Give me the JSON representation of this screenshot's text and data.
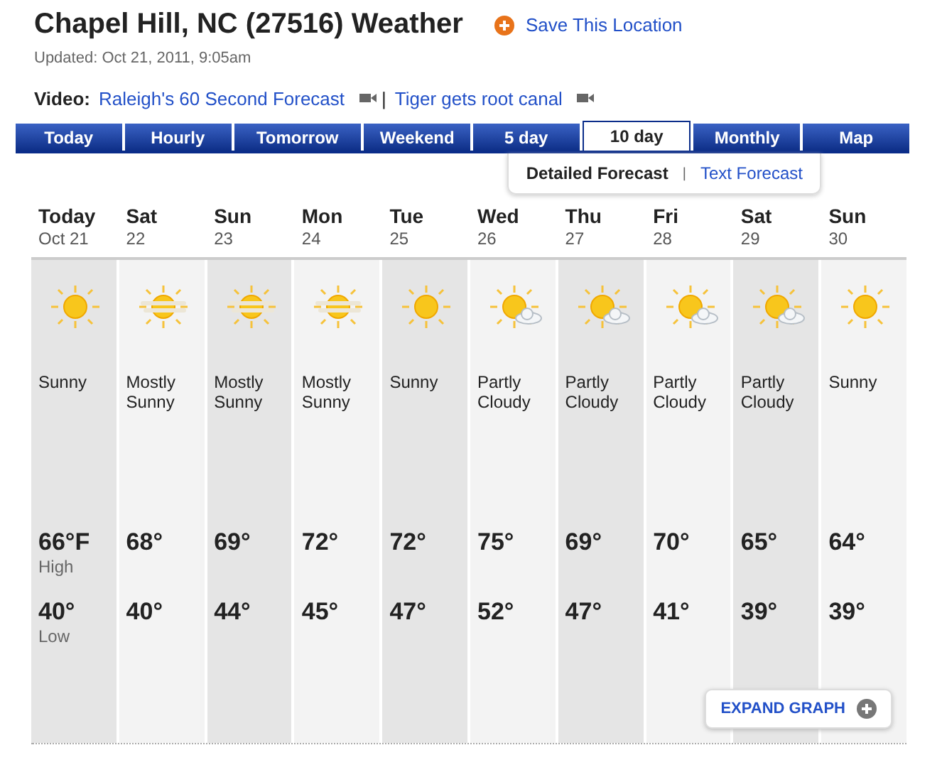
{
  "title": "Chapel Hill, NC (27516) Weather",
  "save_link": "Save This Location",
  "updated": "Updated: Oct 21, 2011, 9:05am",
  "video": {
    "label": "Video:",
    "links": [
      "Raleigh's 60 Second Forecast",
      "Tiger gets root canal"
    ],
    "separator": "|"
  },
  "tabs": [
    {
      "label": "Today",
      "selected": false
    },
    {
      "label": "Hourly",
      "selected": false
    },
    {
      "label": "Tomorrow",
      "selected": false
    },
    {
      "label": "Weekend",
      "selected": false
    },
    {
      "label": "5 day",
      "selected": false
    },
    {
      "label": "10 day",
      "selected": true
    },
    {
      "label": "Monthly",
      "selected": false
    },
    {
      "label": "Map",
      "selected": false
    }
  ],
  "subnav": {
    "items": [
      {
        "label": "Detailed Forecast",
        "selected": true
      },
      {
        "label": "Text Forecast",
        "selected": false
      }
    ],
    "separator": "|"
  },
  "days": [
    {
      "day": "Today",
      "date": "Oct 21",
      "kind": "sunny",
      "condition": "Sunny",
      "high": "66°F",
      "high_label": "High",
      "low": "40°",
      "low_label": "Low"
    },
    {
      "day": "Sat",
      "date": "22",
      "kind": "mostly-sunny",
      "condition": "Mostly Sunny",
      "high": "68°",
      "low": "40°"
    },
    {
      "day": "Sun",
      "date": "23",
      "kind": "mostly-sunny",
      "condition": "Mostly Sunny",
      "high": "69°",
      "low": "44°"
    },
    {
      "day": "Mon",
      "date": "24",
      "kind": "mostly-sunny",
      "condition": "Mostly Sunny",
      "high": "72°",
      "low": "45°"
    },
    {
      "day": "Tue",
      "date": "25",
      "kind": "sunny",
      "condition": "Sunny",
      "high": "72°",
      "low": "47°"
    },
    {
      "day": "Wed",
      "date": "26",
      "kind": "partly-cloudy",
      "condition": "Partly Cloudy",
      "high": "75°",
      "low": "52°"
    },
    {
      "day": "Thu",
      "date": "27",
      "kind": "partly-cloudy",
      "condition": "Partly Cloudy",
      "high": "69°",
      "low": "47°"
    },
    {
      "day": "Fri",
      "date": "28",
      "kind": "partly-cloudy",
      "condition": "Partly Cloudy",
      "high": "70°",
      "low": "41°"
    },
    {
      "day": "Sat",
      "date": "29",
      "kind": "partly-cloudy",
      "condition": "Partly Cloudy",
      "high": "65°",
      "low": "39°"
    },
    {
      "day": "Sun",
      "date": "30",
      "kind": "sunny",
      "condition": "Sunny",
      "high": "64°",
      "low": "39°"
    }
  ],
  "expand_button": "EXPAND GRAPH"
}
